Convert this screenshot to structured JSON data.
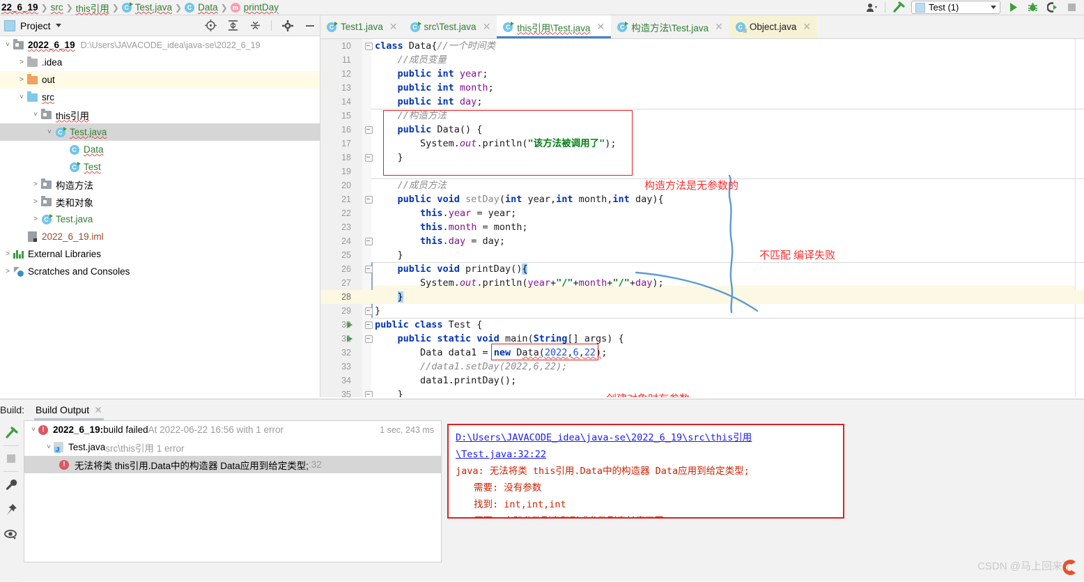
{
  "breadcrumb": {
    "items": [
      {
        "label": "22_6_19",
        "type": "module"
      },
      {
        "label": "src",
        "type": "folder"
      },
      {
        "label": "this引用",
        "type": "package"
      },
      {
        "label": "Test.java",
        "type": "class"
      },
      {
        "label": "Data",
        "type": "class"
      },
      {
        "label": "printDay",
        "type": "method"
      }
    ]
  },
  "runbar": {
    "profile_icon": "user-profile-icon",
    "hammer_icon": "build-hammer-icon",
    "config_name": "Test (1)",
    "run_icon": "run-icon",
    "debug_icon": "debug-icon",
    "coverage_icon": "run-with-coverage-icon",
    "stop_icon": "stop-icon"
  },
  "project_panel": {
    "title": "Project",
    "dropdown_icon": "chevron-down-icon",
    "tools": [
      "locate-icon",
      "expand-all-icon",
      "collapse-all-icon",
      "settings-gear-icon",
      "hide-icon"
    ],
    "tree": [
      {
        "indent": 0,
        "arrow": "v",
        "icon": "module-icon",
        "label": "2022_6_19",
        "bold": true,
        "path": "D:\\Users\\JAVACODE_idea\\java-se\\2022_6_19",
        "state": "normal"
      },
      {
        "indent": 1,
        "arrow": ">",
        "icon": "folder-gray-icon",
        "label": ".idea",
        "state": "normal"
      },
      {
        "indent": 1,
        "arrow": ">",
        "icon": "folder-orange-icon",
        "label": "out",
        "state": "highlight"
      },
      {
        "indent": 1,
        "arrow": "v",
        "icon": "folder-blue-icon",
        "label": "src",
        "state": "normal"
      },
      {
        "indent": 2,
        "arrow": "v",
        "icon": "package-icon",
        "label": "this引用",
        "state": "normal"
      },
      {
        "indent": 3,
        "arrow": "v",
        "icon": "java-class-runnable-icon",
        "label": "Test.java",
        "color": "green",
        "state": "selected"
      },
      {
        "indent": 4,
        "arrow": "",
        "icon": "class-icon",
        "label": "Data",
        "color": "green",
        "state": "normal"
      },
      {
        "indent": 4,
        "arrow": "",
        "icon": "java-class-runnable-icon",
        "label": "Test",
        "color": "green",
        "state": "normal"
      },
      {
        "indent": 2,
        "arrow": ">",
        "icon": "package-icon",
        "label": "构造方法",
        "state": "normal"
      },
      {
        "indent": 2,
        "arrow": ">",
        "icon": "package-icon",
        "label": "类和对象",
        "state": "normal"
      },
      {
        "indent": 2,
        "arrow": ">",
        "icon": "java-class-runnable-icon",
        "label": "Test.java",
        "color": "green",
        "state": "normal"
      },
      {
        "indent": 1,
        "arrow": "",
        "icon": "iml-file-icon",
        "label": "2022_6_19.iml",
        "color": "brown",
        "state": "normal"
      },
      {
        "indent": 0,
        "arrow": ">",
        "icon": "libraries-icon",
        "label": "External Libraries",
        "state": "normal"
      },
      {
        "indent": 0,
        "arrow": ">",
        "icon": "scratches-icon",
        "label": "Scratches and Consoles",
        "state": "normal"
      }
    ]
  },
  "editor_tabs": [
    {
      "label": "Test1.java",
      "icon": "java-class-runnable-icon",
      "active": false,
      "tint": false
    },
    {
      "label": "src\\Test.java",
      "icon": "java-class-runnable-icon",
      "active": false,
      "tint": false
    },
    {
      "label": "this引用\\Test.java",
      "icon": "java-class-runnable-icon",
      "active": true,
      "tint": false
    },
    {
      "label": "构造方法\\Test.java",
      "icon": "java-class-runnable-icon",
      "active": false,
      "tint": false
    },
    {
      "label": "Object.java",
      "icon": "java-class-locked-icon",
      "active": false,
      "tint": true
    }
  ],
  "editor": {
    "first_line": 10,
    "current_line": 28,
    "lines": [
      {
        "n": 10,
        "text": "class Data{//一个时间类"
      },
      {
        "n": 11,
        "text": "    //成员变量"
      },
      {
        "n": 12,
        "text": "    public int year;"
      },
      {
        "n": 13,
        "text": "    public int month;"
      },
      {
        "n": 14,
        "text": "    public int day;"
      },
      {
        "n": 15,
        "text": "    //构造方法"
      },
      {
        "n": 16,
        "text": "    public Data() {"
      },
      {
        "n": 17,
        "text": "        System.out.println(\"该方法被调用了\");"
      },
      {
        "n": 18,
        "text": "    }"
      },
      {
        "n": 19,
        "text": ""
      },
      {
        "n": 20,
        "text": "    //成员方法"
      },
      {
        "n": 21,
        "text": "    public void setDay(int year,int month,int day){"
      },
      {
        "n": 22,
        "text": "        this.year = year;"
      },
      {
        "n": 23,
        "text": "        this.month = month;"
      },
      {
        "n": 24,
        "text": "        this.day = day;"
      },
      {
        "n": 25,
        "text": "    }"
      },
      {
        "n": 26,
        "text": "    public void printDay(){"
      },
      {
        "n": 27,
        "text": "        System.out.println(year+\"/\"+month+\"/\"+day);"
      },
      {
        "n": 28,
        "text": "    }"
      },
      {
        "n": 29,
        "text": "}"
      },
      {
        "n": 30,
        "text": "public class Test {"
      },
      {
        "n": 31,
        "text": "    public static void main(String[] args) {"
      },
      {
        "n": 32,
        "text": "        Data data1 = new Data(2022,6,22);"
      },
      {
        "n": 33,
        "text": "        //data1.setDay(2022,6,22);"
      },
      {
        "n": 34,
        "text": "        data1.printDay();"
      },
      {
        "n": 35,
        "text": "    }"
      }
    ],
    "annotations": [
      {
        "text": "构造方法是无参数的",
        "kind": "red-note"
      },
      {
        "text": "不匹配 编译失败",
        "kind": "red-note"
      },
      {
        "text": "创建对象时有参数",
        "kind": "red-note"
      }
    ]
  },
  "build_panel": {
    "label": "Build:",
    "tab": "Build Output",
    "tab_close_icon": "close-icon",
    "left_icons": [
      "rerun-icon",
      "stop-icon",
      "settings-wrench-icon",
      "pin-icon",
      "eye-icon"
    ],
    "rows": [
      {
        "indent": 0,
        "arrow": "v",
        "icon": "error-icon",
        "title": "2022_6_19:",
        "text": " build failed ",
        "muted": "At 2022-06-22 16:56 with 1 error",
        "time": "1 sec, 243 ms",
        "selected": false
      },
      {
        "indent": 1,
        "arrow": "v",
        "icon": "java-file-icon",
        "title": "",
        "text": "Test.java ",
        "muted": "src\\this引用 1 error",
        "time": "",
        "selected": false
      },
      {
        "indent": 2,
        "arrow": "",
        "icon": "error-icon",
        "title": "",
        "text": "无法将类 this引用.Data中的构造器 Data应用到给定类型;",
        "muted": " :32",
        "time": "",
        "selected": true
      }
    ],
    "error_detail": {
      "link": "D:\\Users\\JAVACODE_idea\\java-se\\2022_6_19\\src\\this引用\\Test.java:32:22",
      "lines": [
        {
          "text": "java: 无法将类 this引用.Data中的构造器 Data应用到给定类型;",
          "indent": false
        },
        {
          "text": "需要: 没有参数",
          "indent": true
        },
        {
          "text": "找到: int,int,int",
          "indent": true
        },
        {
          "text": "原因: 实际参数列表和形式参数列表长度不同",
          "indent": true
        }
      ]
    }
  },
  "watermark": "CSDN @马上回来了"
}
